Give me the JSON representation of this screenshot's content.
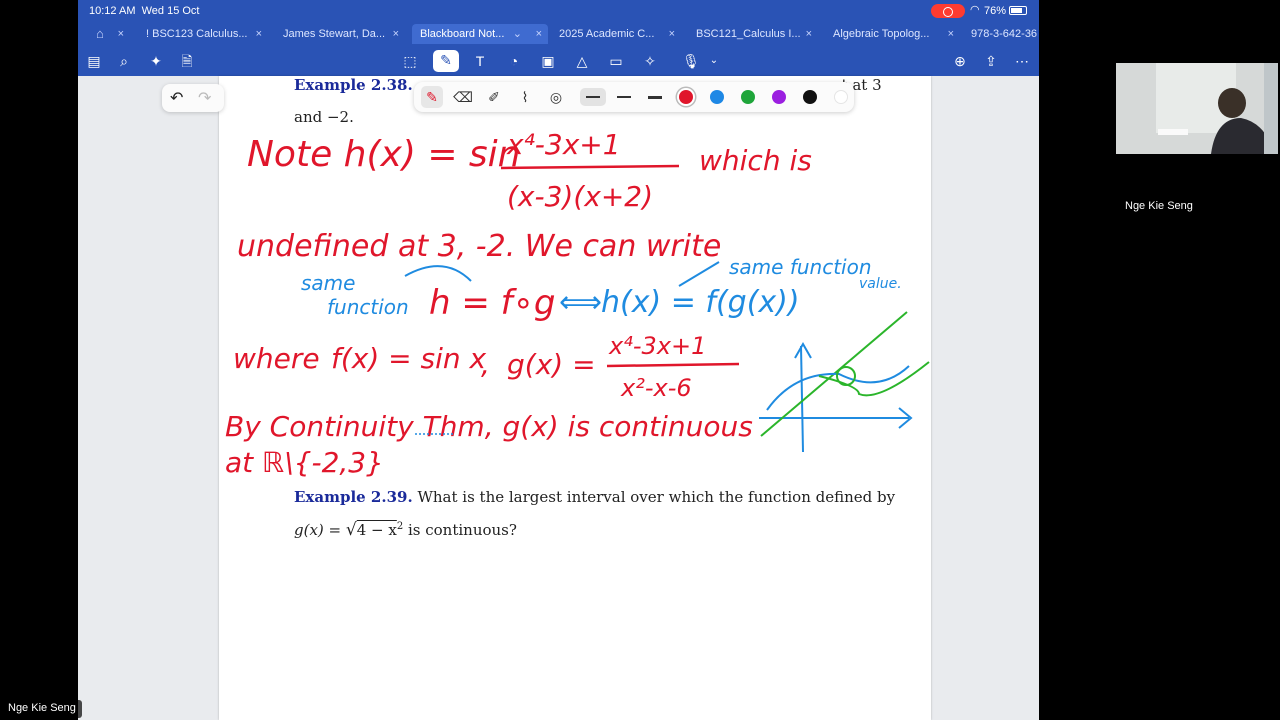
{
  "status": {
    "time": "10:12 AM",
    "date": "Wed 15 Oct",
    "battery": "76%"
  },
  "tabs": [
    {
      "label": "! BSC123 Calculus...",
      "active": false
    },
    {
      "label": "James Stewart, Da...",
      "active": false
    },
    {
      "label": "Blackboard Not...",
      "active": true
    },
    {
      "label": "2025 Academic C...",
      "active": false
    },
    {
      "label": "BSC121_Calculus I...",
      "active": false
    },
    {
      "label": "Algebraic Topolog...",
      "active": false
    },
    {
      "label": "978-3-642-36",
      "active": false
    }
  ],
  "document": {
    "top_example_label": "Example 2.38.",
    "top_line_suffix": "Show that h(x) = sin ... is continuous except at 3",
    "top_line_tail": "es except at 3",
    "top_line2": "and −2.",
    "example_label": "Example 2.39.",
    "example_text": "What is the largest interval over which the function defined by",
    "example_formula_prefix": "g(x) = ",
    "example_formula_sqrt": "4 − x",
    "example_formula_exp": "2",
    "example_formula_suffix": " is continuous?"
  },
  "ink": {
    "line1": "Note h(x) = sin",
    "numerator": "x⁴-3x+1",
    "denominator": "(x-3)(x+2)",
    "which_is": "which is",
    "line2": "undefined at 3, -2. We can write",
    "same_left": "same",
    "function_left": "function",
    "h_eq": "h = f∘g",
    "iff": "⟺",
    "h_x": "h(x) = f(g(x))",
    "same_function": "same function",
    "value": "value.",
    "where": "where",
    "f_def": "f(x) = sin x",
    "comma": ",",
    "g_def": "g(x) =",
    "g_num": "x⁴-3x+1",
    "g_den": "x²-x-6",
    "by_cont": "By Continuity Thm, g(x) is continuous",
    "at_set": "at ℝ\\{-2,3}"
  },
  "colors": {
    "ink_red": "#e0162b",
    "ink_blue": "#1f8be0",
    "ink_green": "#2bb52b",
    "accent": "#2a53b5",
    "palette": [
      "#e0162b",
      "#1e88e5",
      "#1fa53a",
      "#9b1fe0",
      "#111111",
      "#ffffff"
    ]
  },
  "palette_tools": [
    "pen-icon",
    "eraser-icon",
    "highlighter-icon",
    "lasso-icon",
    "shape-icon"
  ],
  "zoom": {
    "participant": "Nge Kie Seng",
    "self_label": "Nge Kie Seng"
  }
}
